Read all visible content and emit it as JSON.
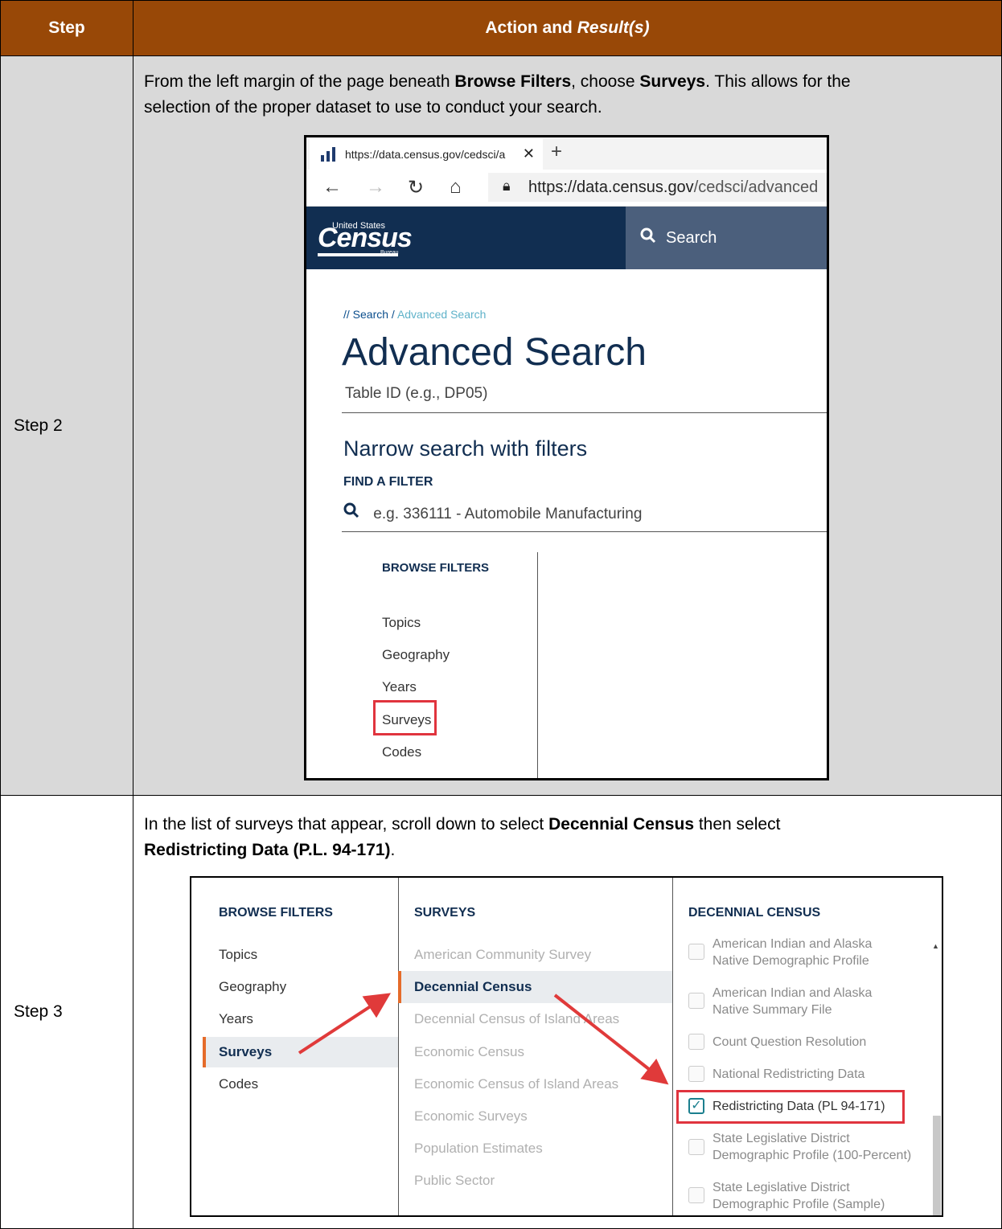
{
  "table": {
    "header": {
      "step": "Step",
      "action_prefix": "Action and ",
      "action_italic": "Result(s)"
    },
    "rows": [
      {
        "step": "Step 2",
        "instruction": {
          "p1": "From the left margin of the page beneath ",
          "b1": "Browse Filters",
          "p2": ", choose ",
          "b2": "Surveys",
          "p3": ". This allows for the",
          "line2": "selection of the proper dataset to use to conduct your search."
        }
      },
      {
        "step": "Step 3",
        "instruction": {
          "p1": "In the list of surveys that appear, scroll down to select ",
          "b1": "Decennial Census",
          "p2": " then select",
          "b2": "Redistricting Data (P.L. 94-171)",
          "p3": "."
        }
      }
    ]
  },
  "screenshot1": {
    "tab_title": "https://data.census.gov/cedsci/a",
    "tab_close": "✕",
    "new_tab": "+",
    "nav": {
      "back": "←",
      "forward": "→",
      "refresh": "↻",
      "home": "⌂"
    },
    "url_host": "https://data.census.gov",
    "url_path": "/cedsci/advanced",
    "logo": {
      "top": "United States",
      "main": "Census",
      "bottom": "Bureau"
    },
    "search_label": "Search",
    "breadcrumb": {
      "root": "// Search",
      "sep": " / ",
      "current": "Advanced Search"
    },
    "heading": "Advanced Search",
    "table_id_placeholder": "Table ID (e.g., DP05)",
    "narrow_heading": "Narrow search with filters",
    "find_filter_label": "FIND A FILTER",
    "filter_placeholder": "e.g. 336111 - Automobile Manufacturing",
    "browse_filters_title": "BROWSE FILTERS",
    "browse_filters": [
      "Topics",
      "Geography",
      "Years",
      "Surveys",
      "Codes"
    ],
    "highlighted": "Surveys",
    "colors": {
      "header_bg": "#984807",
      "navy": "#112e51",
      "highlight": "#e0343e"
    }
  },
  "screenshot2": {
    "col1_title": "BROWSE FILTERS",
    "col1_items": [
      "Topics",
      "Geography",
      "Years",
      "Surveys",
      "Codes"
    ],
    "col1_selected": "Surveys",
    "col2_title": "SURVEYS",
    "col2_items": [
      "American Community Survey",
      "Decennial Census",
      "Decennial Census of Island Areas",
      "Economic Census",
      "Economic Census of Island Areas",
      "Economic Surveys",
      "Population Estimates",
      "Public Sector"
    ],
    "col2_selected": "Decennial Census",
    "col3_title": "DECENNIAL CENSUS",
    "col3_items": [
      {
        "l1": "American Indian and Alaska",
        "l2": "Native Demographic Profile",
        "checked": false
      },
      {
        "l1": "American Indian and Alaska",
        "l2": "Native Summary File",
        "checked": false
      },
      {
        "l1": "Count Question Resolution",
        "l2": "",
        "checked": false
      },
      {
        "l1": "National Redistricting Data",
        "l2": "",
        "checked": false
      },
      {
        "l1": "Redistricting Data (PL 94-171)",
        "l2": "",
        "checked": true
      },
      {
        "l1": "State Legislative District",
        "l2": "Demographic Profile (100-Percent)",
        "checked": false
      },
      {
        "l1": "State Legislative District",
        "l2": "Demographic Profile (Sample)",
        "checked": false
      }
    ],
    "check_mark": "✓"
  }
}
